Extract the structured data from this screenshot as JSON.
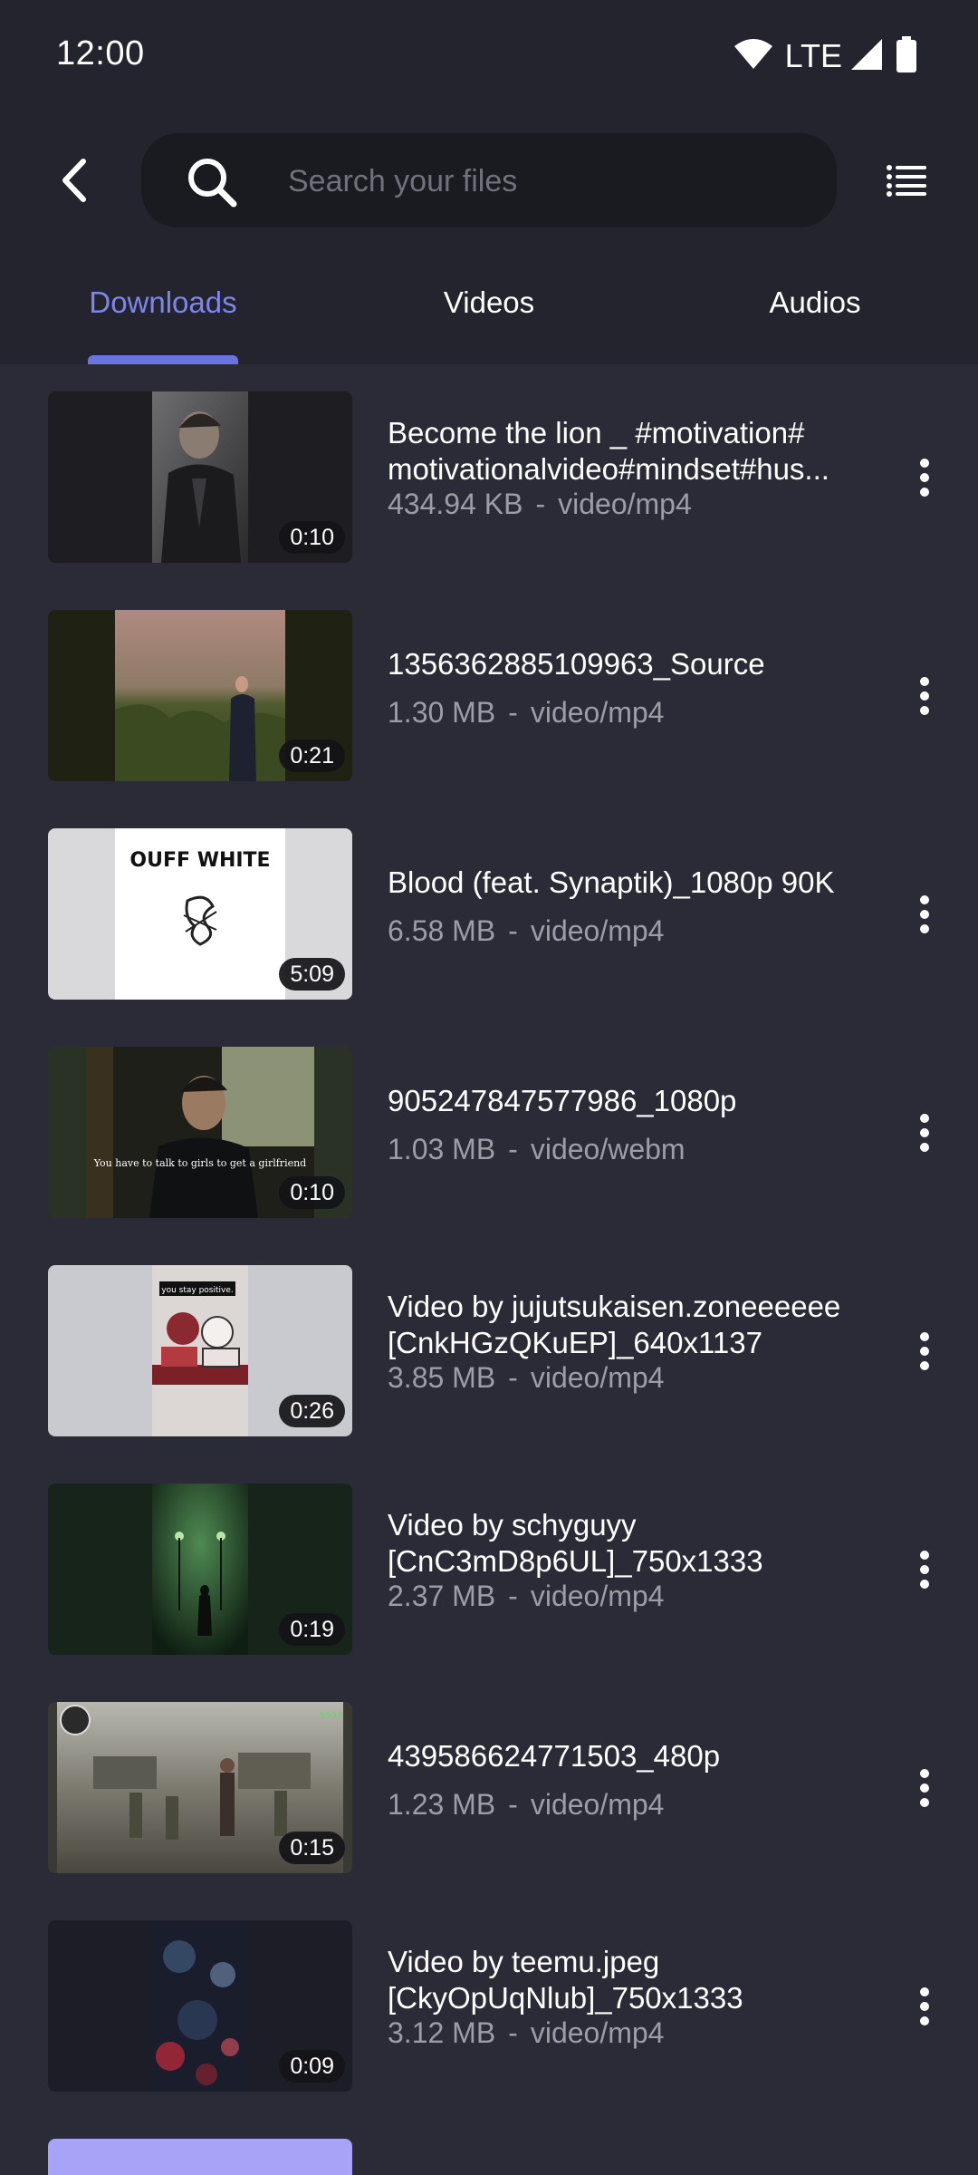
{
  "status_bar": {
    "time": "12:00",
    "network": "LTE"
  },
  "toolbar": {
    "back_icon": "arrow-back-icon",
    "search_placeholder": "Search your files",
    "search_value": "",
    "list_view_icon": "list-view-icon"
  },
  "tabs": [
    {
      "label": "Downloads",
      "active": true
    },
    {
      "label": "Videos",
      "active": false
    },
    {
      "label": "Audios",
      "active": false
    }
  ],
  "colors": {
    "accent": "#6a74e0",
    "background": "#2a2b36",
    "header_background": "#23242d",
    "search_background": "#1a1b21",
    "secondary_text": "#9c9da6"
  },
  "files": [
    {
      "name": "Become the lion _ #motivation# motivationalvideo#mindset#hus...",
      "size": "434.94 KB",
      "type": "video/mp4",
      "duration": "0:10"
    },
    {
      "name": "1356362885109963_Source",
      "size": "1.30 MB",
      "type": "video/mp4",
      "duration": "0:21"
    },
    {
      "name": "Blood (feat. Synaptik)_1080p 90K",
      "size": "6.58 MB",
      "type": "video/mp4",
      "duration": "5:09",
      "thumb_text": "OUFF WHITE"
    },
    {
      "name": "905247847577986_1080p",
      "size": "1.03 MB",
      "type": "video/webm",
      "duration": "0:10",
      "thumb_text": "You have to talk to girls to get a girlfriend"
    },
    {
      "name": "Video by jujutsukaisen.zoneeeeee [CnkHGzQKuEP]_640x1137",
      "size": "3.85 MB",
      "type": "video/mp4",
      "duration": "0:26",
      "thumb_text": "you stay positive."
    },
    {
      "name": "Video by schyguyy [CnC3mD8p6UL]_750x1333",
      "size": "2.37 MB",
      "type": "video/mp4",
      "duration": "0:19"
    },
    {
      "name": "439586624771503_480p",
      "size": "1.23 MB",
      "type": "video/mp4",
      "duration": "0:15"
    },
    {
      "name": "Video by teemu.jpeg [CkyOpUqNlub]_750x1333",
      "size": "3.12 MB",
      "type": "video/mp4",
      "duration": "0:09"
    }
  ],
  "meta_separator": "-",
  "more_icon": "more-vert-icon"
}
